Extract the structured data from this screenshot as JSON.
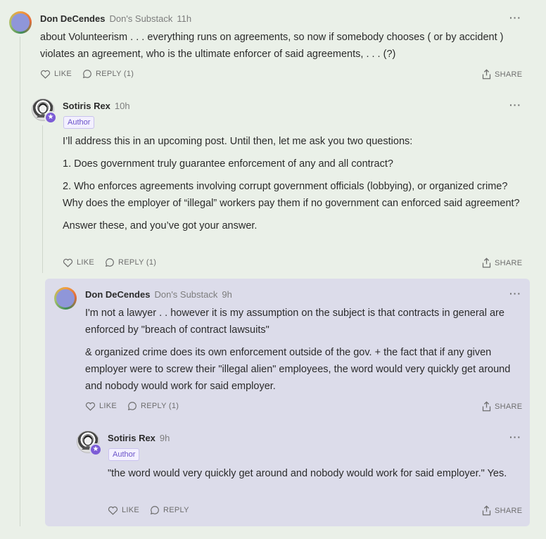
{
  "comments": [
    {
      "name": "Don DeCendes",
      "publication": "Don's Substack",
      "time": "11h",
      "paragraphs": [
        "about Volunteerism . . . everything runs on agreements, so now if somebody chooses ( or by accident ) violates an agreement, who is the ultimate enforcer of said agreements, . . . (?)"
      ],
      "like_label": "LIKE",
      "reply_label": "REPLY (1)",
      "share_label": "SHARE",
      "more_label": "···"
    },
    {
      "name": "Sotiris Rex",
      "time": "10h",
      "badge": "Author",
      "paragraphs": [
        "I’ll address this in an upcoming post. Until then, let me ask you two questions:",
        "1. Does government truly guarantee enforcement of any and all contract?",
        "2. Who enforces agreements involving corrupt government officials (lobbying), or organized crime? Why does the employer of “illegal” workers pay them if no government can enforced said agreement?",
        "Answer these, and you’ve got your answer."
      ],
      "like_label": "LIKE",
      "reply_label": "REPLY (1)",
      "share_label": "SHARE",
      "more_label": "···"
    },
    {
      "name": "Don DeCendes",
      "publication": "Don's Substack",
      "time": "9h",
      "paragraphs": [
        "I'm not a lawyer . . however it is my assumption on the subject is that contracts in general are enforced by \"breach of contract lawsuits\"",
        "& organized crime does its own enforcement outside of the gov. + the fact that if any given employer were to screw their \"illegal alien\" employees, the word would very quickly get around and nobody would work for said employer."
      ],
      "like_label": "LIKE",
      "reply_label": "REPLY (1)",
      "share_label": "SHARE",
      "more_label": "···"
    },
    {
      "name": "Sotiris Rex",
      "time": "9h",
      "badge": "Author",
      "paragraphs": [
        "\"the word would very quickly get around and nobody would work for said employer.\" Yes."
      ],
      "like_label": "LIKE",
      "reply_label": "REPLY",
      "share_label": "SHARE",
      "more_label": "···"
    }
  ],
  "colors": {
    "background": "#eaf0e8",
    "highlight_panel": "#dcdcea",
    "author_badge": "#6b53c9",
    "star_badge": "#7c5cd6"
  },
  "icons": {
    "like": "heart-icon",
    "reply": "speech-bubble-icon",
    "share": "share-upload-icon",
    "more": "ellipsis-icon",
    "author_star": "star-icon"
  }
}
